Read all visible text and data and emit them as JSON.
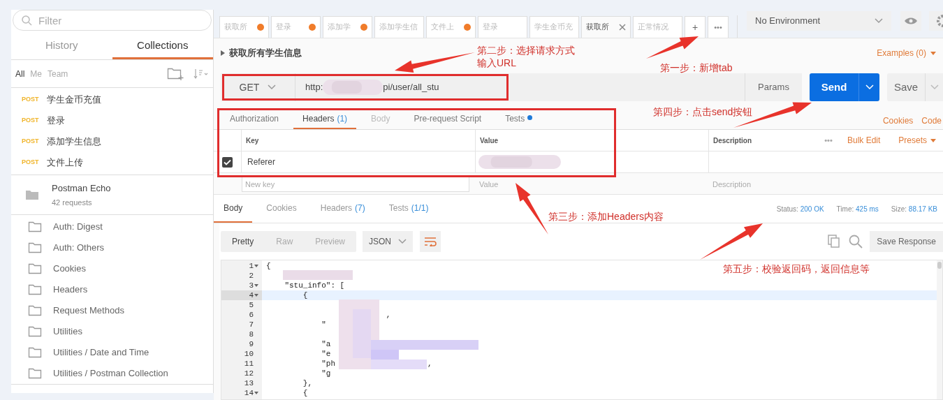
{
  "sidebar": {
    "filter": {
      "placeholder": "Filter"
    },
    "tabs": [
      {
        "label": "History",
        "selected": false
      },
      {
        "label": "Collections",
        "selected": true
      }
    ],
    "scopes": [
      {
        "label": "All",
        "selected": true
      },
      {
        "label": "Me",
        "selected": false
      },
      {
        "label": "Team",
        "selected": false
      }
    ],
    "requests": [
      {
        "method": "POST",
        "name": "学生金币充值"
      },
      {
        "method": "POST",
        "name": "登录"
      },
      {
        "method": "POST",
        "name": "添加学生信息"
      },
      {
        "method": "POST",
        "name": "文件上传"
      }
    ],
    "collection": {
      "name": "Postman Echo",
      "count": "42 requests"
    },
    "folders": [
      "Auth: Digest",
      "Auth: Others",
      "Cookies",
      "Headers",
      "Request Methods",
      "Utilities",
      "Utilities / Date and Time",
      "Utilities / Postman Collection"
    ]
  },
  "tabs": [
    {
      "label": "获取所",
      "unsaved": true,
      "selected": false
    },
    {
      "label": "登录",
      "unsaved": true,
      "selected": false
    },
    {
      "label": "添加学",
      "unsaved": true,
      "selected": false
    },
    {
      "label": "添加学生信",
      "unsaved": false,
      "selected": false
    },
    {
      "label": "文件上",
      "unsaved": true,
      "selected": false
    },
    {
      "label": "登录",
      "unsaved": false,
      "selected": false
    },
    {
      "label": "学生金币充",
      "unsaved": false,
      "selected": false
    },
    {
      "label": "获取所",
      "unsaved": false,
      "selected": true
    },
    {
      "label": "正常情况",
      "unsaved": false,
      "selected": false
    }
  ],
  "new_tab": "+",
  "more_tabs": "•••",
  "environment": "No Environment",
  "request": {
    "title": "获取所有学生信息",
    "examples": "Examples (0)",
    "method": "GET",
    "url_start": "http:",
    "url_end": "pi/user/all_stu",
    "params": "Params",
    "send": "Send",
    "save": "Save",
    "tabs": [
      {
        "label": "Authorization",
        "selected": false,
        "disabled": false,
        "dot": false
      },
      {
        "label": "Headers",
        "count": "(1)",
        "selected": true,
        "disabled": false,
        "dot": false
      },
      {
        "label": "Body",
        "selected": false,
        "disabled": true,
        "dot": false
      },
      {
        "label": "Pre-request Script",
        "selected": false,
        "disabled": false,
        "dot": false
      },
      {
        "label": "Tests",
        "selected": false,
        "disabled": false,
        "dot": true
      }
    ],
    "links": [
      "Cookies",
      "Code"
    ],
    "headers": {
      "columns": [
        "Key",
        "Value",
        "Description"
      ],
      "more": "•••",
      "bulk_edit": "Bulk Edit",
      "presets": "Presets",
      "rows": [
        {
          "key": "Referer",
          "checked": true
        }
      ],
      "new_row": {
        "key": {
          "placeholder": "New key"
        },
        "value": {
          "placeholder": "Value"
        },
        "description": {
          "placeholder": "Description"
        }
      }
    }
  },
  "response": {
    "tabs": [
      {
        "label": "Body",
        "selected": true
      },
      {
        "label": "Cookies",
        "selected": false
      },
      {
        "label": "Headers",
        "count": "(7)",
        "selected": false
      },
      {
        "label": "Tests",
        "count": "(1/1)",
        "selected": false
      }
    ],
    "stats": [
      {
        "label": "Status:",
        "value": "200 OK"
      },
      {
        "label": "Time:",
        "value": "425 ms"
      },
      {
        "label": "Size:",
        "value": "88.17 KB"
      }
    ],
    "views": [
      {
        "label": "Pretty",
        "selected": true
      },
      {
        "label": "Raw",
        "selected": false
      },
      {
        "label": "Preview",
        "selected": false
      }
    ],
    "format": "JSON",
    "save": "Save Response",
    "lines": [
      {
        "number": "1",
        "text": "{",
        "fold": true,
        "current": false
      },
      {
        "number": "2",
        "fold": false,
        "current": false
      },
      {
        "number": "3",
        "text": "    \"stu_info\": [",
        "fold": true,
        "current": false
      },
      {
        "number": "4",
        "text": "        {",
        "fold": true,
        "current": true
      },
      {
        "number": "5",
        "fold": false,
        "current": false
      },
      {
        "number": "6",
        "text": "                          ,",
        "fold": false,
        "current": false
      },
      {
        "number": "7",
        "text": "            \"",
        "fold": false,
        "current": false
      },
      {
        "number": "8",
        "fold": false,
        "current": false
      },
      {
        "number": "9",
        "text": "            \"a",
        "fold": false,
        "current": false
      },
      {
        "number": "10",
        "text": "            \"e",
        "fold": false,
        "current": false
      },
      {
        "number": "11",
        "text": "            \"ph                    ,",
        "fold": false,
        "current": false
      },
      {
        "number": "12",
        "text": "            \"g",
        "fold": false,
        "current": false
      },
      {
        "number": "13",
        "text": "        },",
        "fold": false,
        "current": false
      },
      {
        "number": "14",
        "text": "        {",
        "fold": true,
        "current": false
      }
    ]
  },
  "annotations": [
    "第二步：选择请求方式",
    "输入URL",
    "第一步：新增tab",
    "第四步：点击send按钮",
    "第三步：添加Headers内容",
    "第五步：校验返回码，返回信息等"
  ]
}
